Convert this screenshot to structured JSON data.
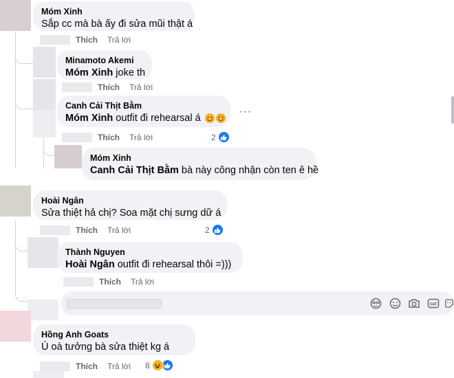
{
  "actions": {
    "like": "Thích",
    "reply": "Trả lời"
  },
  "comments": [
    {
      "author": "Móm Xinh",
      "mention": "",
      "text": "Sắp cc mà bà ấy đi sửa mũi thật á",
      "reactions": ""
    },
    {
      "author": "Minamoto Akemi",
      "mention": "Móm Xinh",
      "text": " joke th",
      "reactions": ""
    },
    {
      "author": "Canh Cải Thịt Bằm",
      "mention": "Móm Xinh",
      "text": " outfit đi rehearsal á",
      "reactions": "2"
    },
    {
      "author": "Móm Xinh",
      "mention": "Canh Cải Thịt Bằm",
      "text": " bà này công nhận còn ten ê hề",
      "reactions": ""
    },
    {
      "author": "Hoài Ngân",
      "mention": "",
      "text": "Sửa thiệt hả chị? Soa mặt chị sưng dữ á",
      "reactions": "2"
    },
    {
      "author": "Thành Nguyen",
      "mention": "Hoài Ngân",
      "text": " outfit đi rehearsal thôi =)))",
      "reactions": ""
    },
    {
      "author": "Hồng Anh Goats",
      "mention": "",
      "text": "Ú oà tưởng bà sửa thiệt kg á",
      "reactions": "8"
    }
  ],
  "more_label": "···",
  "icons": {
    "like": "thumbs-up-icon",
    "haha": "haha-emoji-icon",
    "smile": "smile-emoji-icon",
    "composer": [
      "avatar-frame-icon",
      "emoji-icon",
      "camera-icon",
      "gif-icon",
      "sticker-icon"
    ]
  },
  "colors": {
    "bubble": "#f0f2f5",
    "like_blue": "#1877f2",
    "secondary_text": "#65676b",
    "haha_yellow": "#f7b125"
  }
}
